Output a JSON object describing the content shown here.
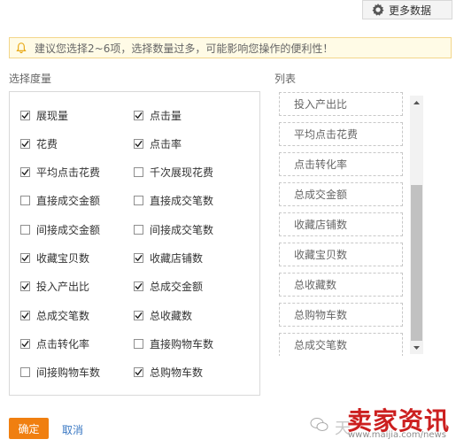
{
  "toolbar": {
    "more_data_label": "更多数据"
  },
  "tip": {
    "text": "建议您选择2~6项，选择数量过多，可能影响您操作的便利性！"
  },
  "sections": {
    "choose_metrics": "选择度量",
    "list": "列表"
  },
  "metrics": [
    {
      "label": "展现量",
      "checked": true
    },
    {
      "label": "点击量",
      "checked": true
    },
    {
      "label": "花费",
      "checked": true
    },
    {
      "label": "点击率",
      "checked": true
    },
    {
      "label": "平均点击花费",
      "checked": true
    },
    {
      "label": "千次展现花费",
      "checked": false
    },
    {
      "label": "直接成交金额",
      "checked": false
    },
    {
      "label": "直接成交笔数",
      "checked": false
    },
    {
      "label": "间接成交金额",
      "checked": false
    },
    {
      "label": "间接成交笔数",
      "checked": false
    },
    {
      "label": "收藏宝贝数",
      "checked": true
    },
    {
      "label": "收藏店铺数",
      "checked": true
    },
    {
      "label": "投入产出比",
      "checked": true
    },
    {
      "label": "总成交金额",
      "checked": true
    },
    {
      "label": "总成交笔数",
      "checked": true
    },
    {
      "label": "总收藏数",
      "checked": true
    },
    {
      "label": "点击转化率",
      "checked": true
    },
    {
      "label": "直接购物车数",
      "checked": false
    },
    {
      "label": "间接购物车数",
      "checked": false
    },
    {
      "label": "总购物车数",
      "checked": true
    }
  ],
  "list_items": [
    "投入产出比",
    "平均点击花费",
    "点击转化率",
    "总成交金额",
    "收藏店铺数",
    "收藏宝贝数",
    "总收藏数",
    "总购物车数",
    "总成交笔数"
  ],
  "buttons": {
    "ok": "确定",
    "cancel": "取消"
  },
  "watermark": {
    "faded": "天",
    "brand": "卖家资讯",
    "url": "www.maijia.com/news"
  },
  "colors": {
    "accent": "#f07f10",
    "link": "#3a78c3",
    "watermark": "#cc1f1f"
  }
}
